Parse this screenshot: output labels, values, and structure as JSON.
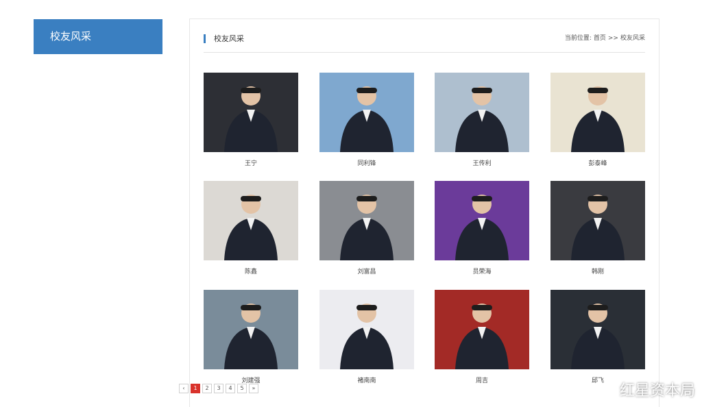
{
  "sidebar": {
    "tab_label": "校友风采"
  },
  "panel": {
    "title": "校友风采",
    "breadcrumb": {
      "prefix": "当前位置:",
      "home": "首页",
      "separator": ">>",
      "current": "校友风采"
    }
  },
  "alumni": [
    {
      "name": "王宁",
      "bg": "#2d2f35"
    },
    {
      "name": "同利锋",
      "bg": "#7fa8cf"
    },
    {
      "name": "王传利",
      "bg": "#aebfcf"
    },
    {
      "name": "彭泰峰",
      "bg": "#e9e3d2"
    },
    {
      "name": "陈鑫",
      "bg": "#dcd9d4"
    },
    {
      "name": "刘富昌",
      "bg": "#8a8d92"
    },
    {
      "name": "员荣海",
      "bg": "#6b3b9a"
    },
    {
      "name": "韩刚",
      "bg": "#3a3b40"
    },
    {
      "name": "刘建强",
      "bg": "#7a8c9a"
    },
    {
      "name": "褚南南",
      "bg": "#ececf0"
    },
    {
      "name": "周吉",
      "bg": "#a32a26"
    },
    {
      "name": "邱飞",
      "bg": "#2a2f36"
    }
  ],
  "pagination": {
    "items": [
      "‹",
      "1",
      "2",
      "3",
      "4",
      "5",
      "»"
    ],
    "active_index": 1
  },
  "watermark": {
    "text": "红星资本局"
  }
}
